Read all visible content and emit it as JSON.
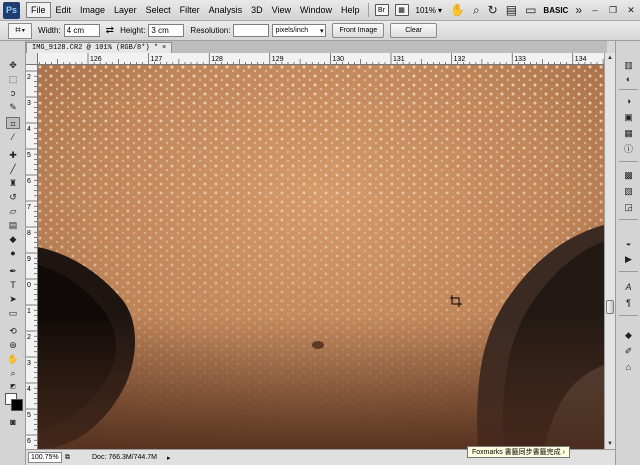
{
  "menubar": {
    "logo": "Ps",
    "items": [
      "File",
      "Edit",
      "Image",
      "Layer",
      "Select",
      "Filter",
      "Analysis",
      "3D",
      "View",
      "Window",
      "Help"
    ],
    "zoom": "101%",
    "workspace": "BASIC"
  },
  "options": {
    "width_label": "Width:",
    "width_value": "4 cm",
    "height_label": "Height:",
    "height_value": "3 cm",
    "resolution_label": "Resolution:",
    "resolution_value": "",
    "units": "pixels/inch",
    "front_image_label": "Front Image",
    "clear_label": "Clear"
  },
  "document": {
    "tab_title": "IMG_9128.CR2 @ 101% (RGB/8*) *",
    "close": "×"
  },
  "rulers": {
    "h_labels": [
      "126",
      "127",
      "128",
      "129",
      "130",
      "131",
      "132",
      "133",
      "134"
    ],
    "v_labels": [
      "2",
      "3",
      "4",
      "5",
      "6",
      "7",
      "8",
      "9",
      "0",
      "1",
      "2",
      "3",
      "4",
      "5",
      "6"
    ]
  },
  "status": {
    "zoom": "100.75%",
    "doc": "Doc: 766.3M/744.7M"
  },
  "tooltip": "Foxmarks 書籤同步書籤完成 ›",
  "colors": {
    "skin": "#c3895c",
    "nostril": "#1e1511"
  }
}
